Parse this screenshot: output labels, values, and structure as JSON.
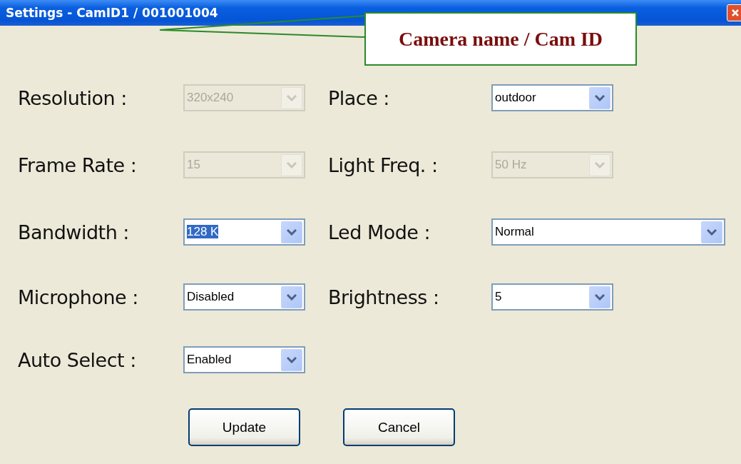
{
  "window": {
    "title": "Settings - CamID1 / 001001004"
  },
  "callout": {
    "text": "Camera name / Cam ID"
  },
  "rows": [
    {
      "left": {
        "label": "Resolution :",
        "value": "320x240",
        "disabled": true,
        "text_selected": false
      },
      "right": {
        "label": "Place :",
        "value": "outdoor",
        "disabled": false,
        "text_selected": false
      }
    },
    {
      "left": {
        "label": "Frame Rate :",
        "value": "15",
        "disabled": true,
        "text_selected": false
      },
      "right": {
        "label": "Light Freq. :",
        "value": "50 Hz",
        "disabled": true,
        "text_selected": false
      }
    },
    {
      "left": {
        "label": "Bandwidth :",
        "value": "128 K",
        "disabled": false,
        "text_selected": true
      },
      "right": {
        "label": "Led Mode :",
        "value": "Normal",
        "disabled": false,
        "text_selected": false
      }
    },
    {
      "left": {
        "label": "Microphone :",
        "value": "Disabled",
        "disabled": false,
        "text_selected": false
      },
      "right": {
        "label": "Brightness :",
        "value": "5",
        "disabled": false,
        "text_selected": false
      }
    },
    {
      "left": {
        "label": "Auto Select :",
        "value": "Enabled",
        "disabled": false,
        "text_selected": false
      }
    }
  ],
  "buttons": [
    "Update",
    "Cancel"
  ]
}
